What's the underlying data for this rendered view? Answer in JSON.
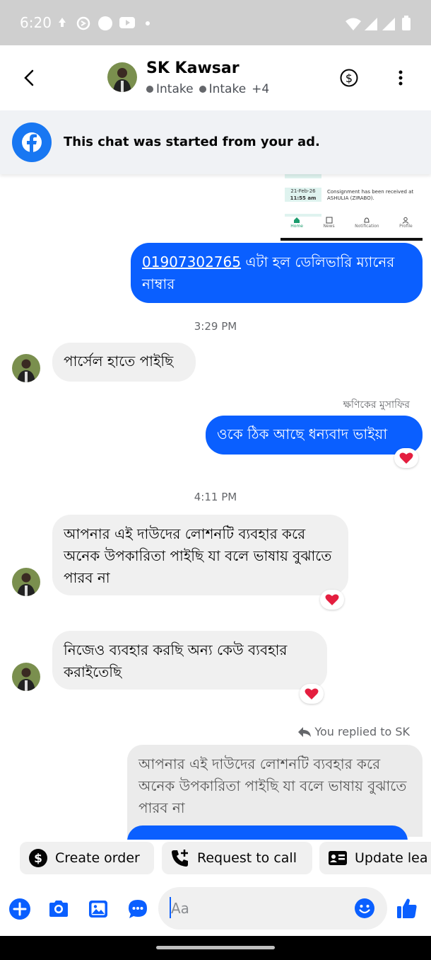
{
  "status_bar": {
    "time": "6:20"
  },
  "header": {
    "contact_name": "SK Kawsar",
    "tags": [
      "Intake",
      "Intake"
    ],
    "tags_more": "+4"
  },
  "ad_banner": {
    "text": "This chat was started from your ad."
  },
  "image_preview": {
    "date_label": "21-Feb-26",
    "time_label": "11:55 am",
    "event_text": "Consignment has been received at ASHULIA (ZIRABO).",
    "nav": [
      "Home",
      "News",
      "Notification",
      "Profile"
    ]
  },
  "messages": {
    "m1": {
      "phone": "01907302765",
      "text": " এটা হল ডেলিভারি ম্যানের নাম্বার"
    },
    "ts1": "3:29 PM",
    "m2": {
      "text": "পার্সেল হাতে পাইছি"
    },
    "sender_label": "ক্ষণিকের মুসাফির",
    "m3": {
      "text": "ওকে ঠিক আছে ধন্যবাদ ভাইয়া"
    },
    "ts2": "4:11 PM",
    "m4": {
      "text": "আপনার এই দাউদের লোশনটি ব্যবহার করে অনেক উপকারিতা পাইছি যা বলে ভাষায় বুঝাতে পারব না"
    },
    "m5": {
      "text": "নিজেও ব্যবহার করছি অন্য কেউ ব্যবহার করাইতেছি"
    },
    "replied_label": "You replied to SK",
    "quoted": {
      "text": "আপনার এই দাউদের লোশনটি ব্যবহার করে অনেক উপকারিতা পাইছি যা বলে ভাষায় বুঝাতে পারব না"
    }
  },
  "quick_actions": [
    {
      "label": "Create order",
      "icon": "dollar-circle-icon"
    },
    {
      "label": "Request to call",
      "icon": "phone-plus-icon"
    },
    {
      "label": "Update lea",
      "icon": "id-card-icon"
    }
  ],
  "composer": {
    "placeholder": "Aa"
  },
  "colors": {
    "accent": "#0a5fff",
    "facebook": "#1877f2",
    "reaction": "#e41e3f"
  }
}
